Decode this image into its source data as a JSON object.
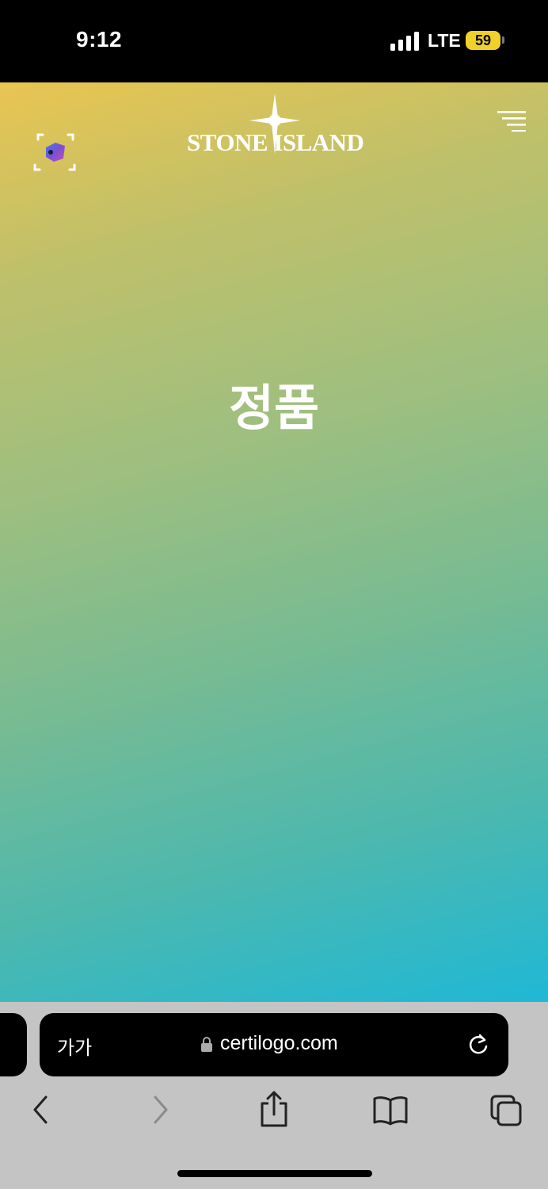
{
  "status_bar": {
    "time": "9:12",
    "network": "LTE",
    "battery": "59"
  },
  "brand": {
    "name": "STONE ISLAND"
  },
  "result": {
    "text": "정품"
  },
  "browser": {
    "text_size_label": "가가",
    "url": "certilogo.com"
  },
  "icons": {
    "scan": "scan-icon",
    "menu": "menu-icon",
    "lock": "lock-icon",
    "reload": "reload-icon",
    "back": "back-icon",
    "forward": "forward-icon",
    "share": "share-icon",
    "bookmarks": "bookmarks-icon",
    "tabs": "tabs-icon"
  },
  "colors": {
    "gradient_top": "#e9c551",
    "gradient_bottom": "#1fb8d6",
    "toolbar": "#c4c4c4"
  }
}
